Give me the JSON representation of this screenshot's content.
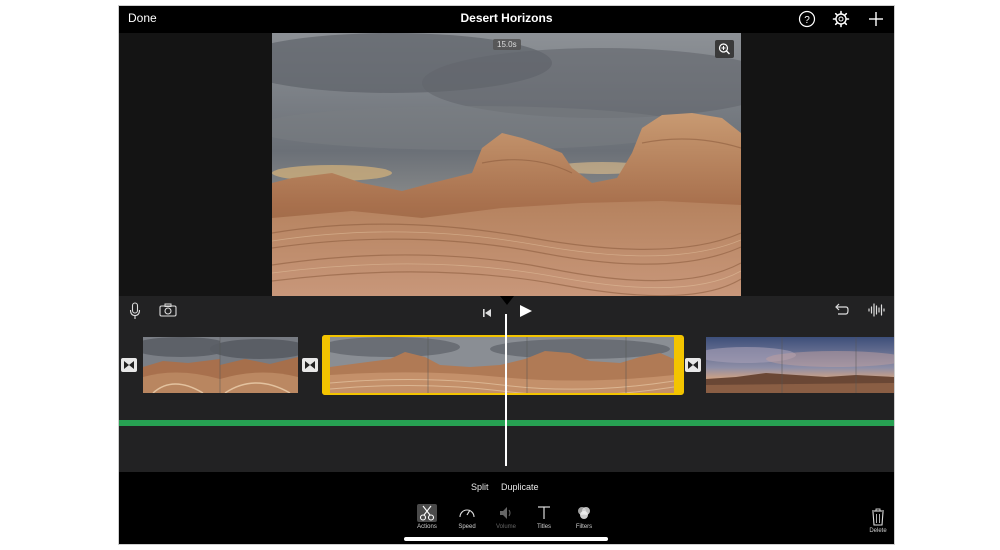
{
  "topbar": {
    "done_label": "Done",
    "title": "Desert Horizons",
    "icons": [
      "help-icon",
      "settings-gear-icon",
      "add-icon"
    ]
  },
  "viewer": {
    "duration_badge": "15.0s",
    "zoom_icon": "zoom-in-icon"
  },
  "timeline": {
    "left_icons": [
      "microphone-icon",
      "camera-icon"
    ],
    "transport_icons": [
      "skip-to-start-icon",
      "play-icon"
    ],
    "right_icons": [
      "undo-icon",
      "audio-waveform-icon"
    ],
    "clips": [
      "clip-1",
      "clip-2",
      "clip-3"
    ],
    "selected_clip": "clip-2"
  },
  "actions": {
    "split_label": "Split",
    "duplicate_label": "Duplicate"
  },
  "toolbar": {
    "actions_label": "Actions",
    "speed_label": "Speed",
    "volume_label": "Volume",
    "titles_label": "Titles",
    "filters_label": "Filters",
    "delete_label": "Delete"
  },
  "colors": {
    "selection": "#f3c400",
    "audio_track": "#27a152",
    "background": "#000000"
  }
}
